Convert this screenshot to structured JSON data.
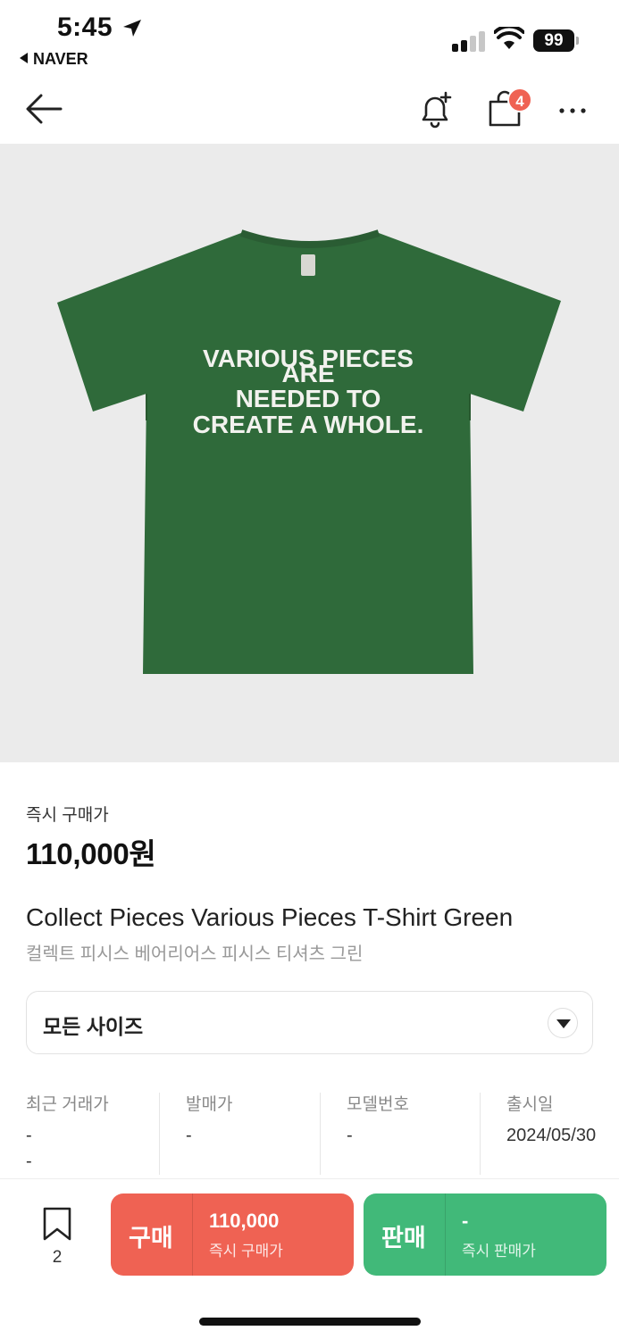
{
  "status_bar": {
    "time": "5:45",
    "back_app": "NAVER",
    "battery": "99"
  },
  "header": {
    "cart_badge": "4"
  },
  "product": {
    "shirt_print_lines": [
      "VARIOUS PIECES",
      "ARE",
      "NEEDED TO",
      "CREATE A WHOLE."
    ],
    "price_label": "즉시 구매가",
    "price": "110,000원",
    "title_en": "Collect Pieces Various Pieces T-Shirt Green",
    "title_ko": "컬렉트 피시스 베어리어스 피시스 티셔츠 그린"
  },
  "size_select": {
    "label": "모든 사이즈"
  },
  "info": [
    {
      "key": "최근 거래가",
      "value": "-",
      "value2": "-"
    },
    {
      "key": "발매가",
      "value": "-"
    },
    {
      "key": "모델번호",
      "value": "-"
    },
    {
      "key": "출시일",
      "value": "2024/05/30"
    }
  ],
  "bottom_bar": {
    "wish_count": "2",
    "buy": {
      "label": "구매",
      "amount": "110,000",
      "sub": "즉시 구매가"
    },
    "sell": {
      "label": "판매",
      "amount": "-",
      "sub": "즉시 판매가"
    }
  },
  "colors": {
    "buy": "#ef6253",
    "sell": "#41b979",
    "shirt": "#2f6a3a",
    "image_bg": "#ebebeb"
  },
  "icons": [
    "location-arrow-icon",
    "signal-icon",
    "wifi-icon",
    "back-arrow-icon",
    "bell-plus-icon",
    "shopping-bag-icon",
    "more-icon",
    "chevron-down-icon",
    "bookmark-icon"
  ]
}
